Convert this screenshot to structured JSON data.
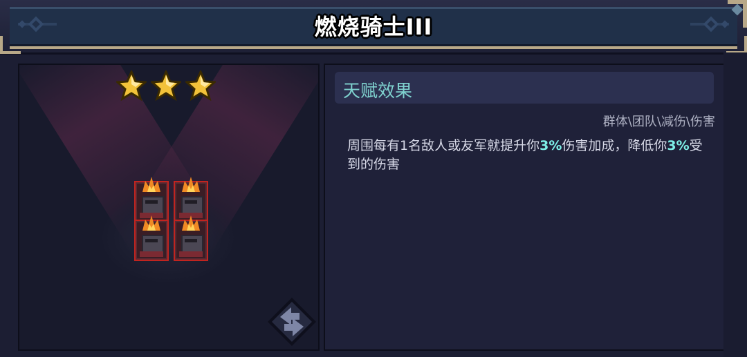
{
  "header": {
    "title": "燃烧骑士III"
  },
  "left": {
    "star_count": 3,
    "units": [
      "burning-knight",
      "burning-knight",
      "burning-knight",
      "burning-knight"
    ],
    "swap_icon": "swap-arrows-icon"
  },
  "talent": {
    "section_title": "天赋效果",
    "tags": "群体\\团队\\减伤\\伤害",
    "desc_part1": "周围每有1名敌人或友军就提升你",
    "desc_value1": "3%",
    "desc_part2": "伤害加成，降低你",
    "desc_value2": "3%",
    "desc_part3": "受到的伤害"
  },
  "colors": {
    "highlight": "#7ef0e8",
    "title_teal": "#7fd2cf",
    "unit_border": "#c2241f"
  }
}
